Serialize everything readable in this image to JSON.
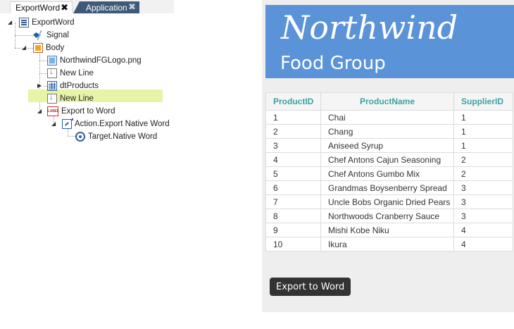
{
  "tabs": [
    {
      "label": "ExportWord",
      "active": true,
      "close": "✖"
    },
    {
      "label": "Application",
      "active": false,
      "close": "✖"
    }
  ],
  "tree": {
    "root": "ExportWord",
    "signal": "Signal",
    "body": "Body",
    "logo": "NorthwindFGLogo.png",
    "newline1": "New Line",
    "dtproducts": "dtProducts",
    "newline2": "New Line",
    "export_label": "Export to Word",
    "action": "Action.Export Native Word",
    "target": "Target.Native Word"
  },
  "banner": {
    "title": "Northwind",
    "subtitle": "Food Group",
    "color": "#5a93d8"
  },
  "table": {
    "headers": [
      "ProductID",
      "ProductName",
      "SupplierID"
    ],
    "rows": [
      [
        "1",
        "Chai",
        "1"
      ],
      [
        "2",
        "Chang",
        "1"
      ],
      [
        "3",
        "Aniseed Syrup",
        "1"
      ],
      [
        "4",
        "Chef Antons Cajun Seasoning",
        "2"
      ],
      [
        "5",
        "Chef Antons Gumbo Mix",
        "2"
      ],
      [
        "6",
        "Grandmas Boysenberry Spread",
        "3"
      ],
      [
        "7",
        "Uncle Bobs Organic Dried Pears",
        "3"
      ],
      [
        "8",
        "Northwoods Cranberry Sauce",
        "3"
      ],
      [
        "9",
        "Mishi Kobe Niku",
        "4"
      ],
      [
        "10",
        "Ikura",
        "4"
      ]
    ],
    "header_color": "#3aa3a0"
  },
  "export_button": "Export to Word"
}
